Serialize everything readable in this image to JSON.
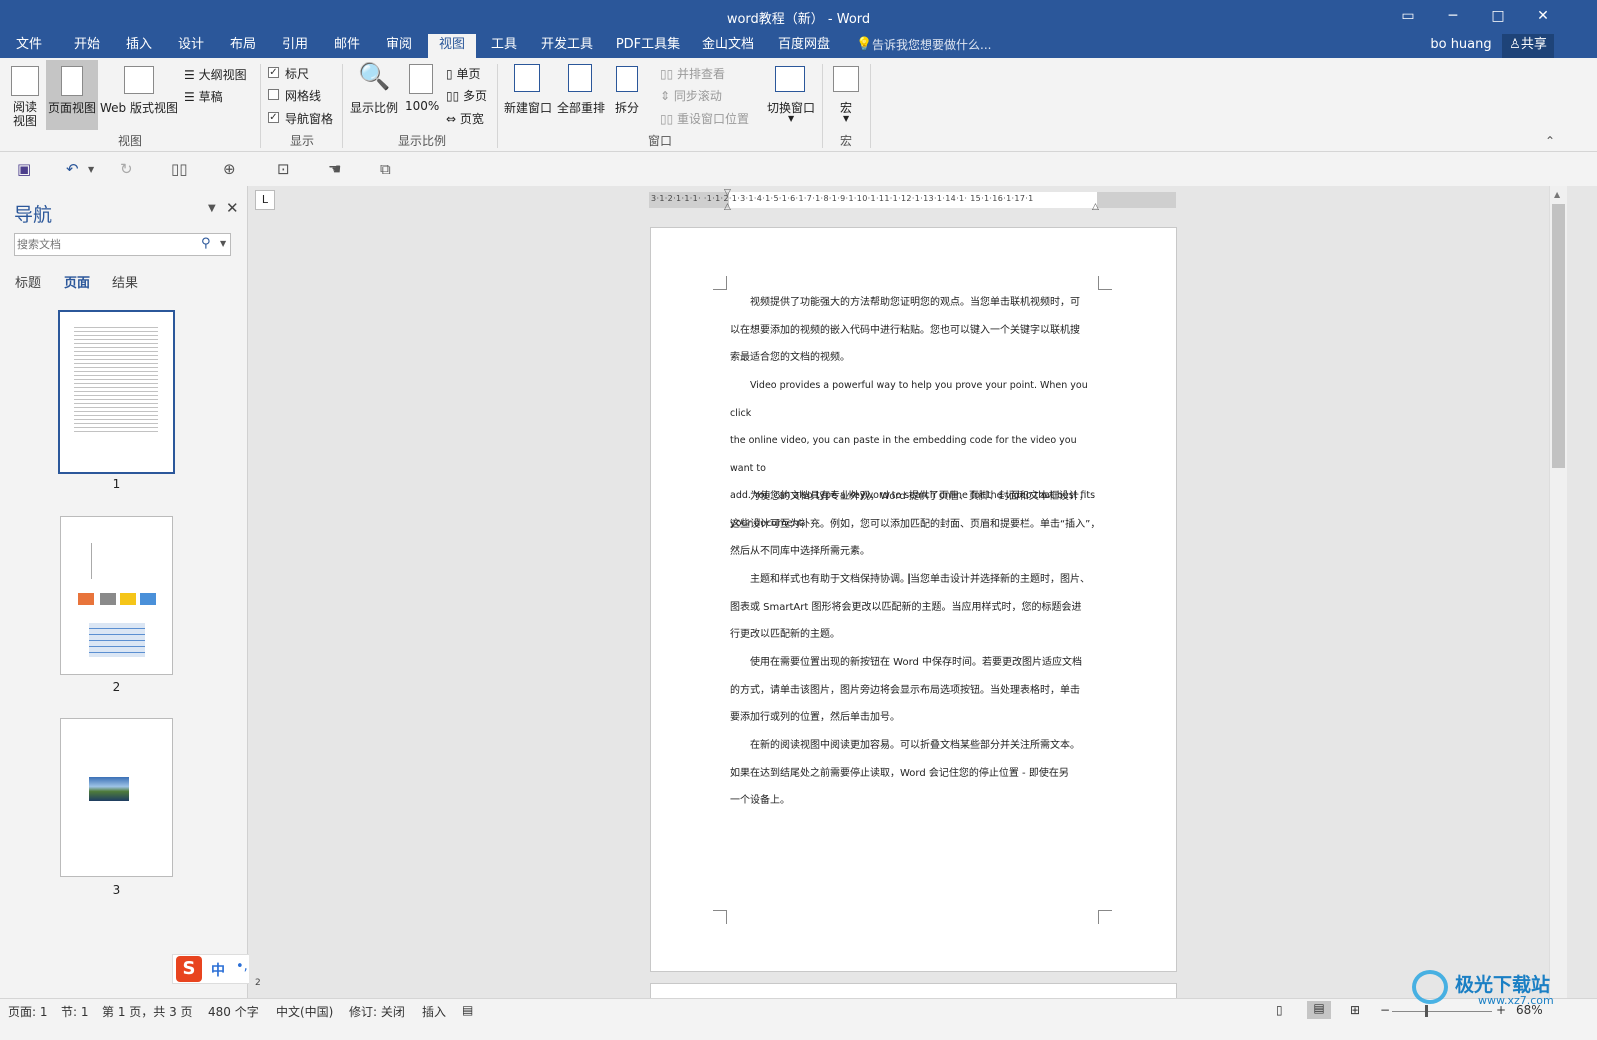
{
  "window": {
    "title": "word教程（新） - Word",
    "user": "bo huang",
    "share_label": "共享",
    "colors": {
      "title_bar": "#2b579a",
      "ribbon": "#f3f3f3",
      "accent": "#2b579a"
    }
  },
  "tabs": [
    {
      "label": "文件"
    },
    {
      "label": "开始"
    },
    {
      "label": "插入"
    },
    {
      "label": "设计"
    },
    {
      "label": "布局"
    },
    {
      "label": "引用"
    },
    {
      "label": "邮件"
    },
    {
      "label": "审阅"
    },
    {
      "label": "视图",
      "active": true
    },
    {
      "label": "工具"
    },
    {
      "label": "开发工具"
    },
    {
      "label": "PDF工具集"
    },
    {
      "label": "金山文档"
    },
    {
      "label": "百度网盘"
    }
  ],
  "tell_me": "告诉我您想要做什么...",
  "ribbon": {
    "views": {
      "read": "阅读\n视图",
      "read_l1": "阅读",
      "read_l2": "视图",
      "print_layout": "页面视图",
      "web_layout": "Web 版式视图",
      "outline": "大纲视图",
      "draft": "草稿",
      "group": "视图"
    },
    "show": {
      "ruler": "标尺",
      "gridlines": "网格线",
      "nav_pane": "导航窗格",
      "ruler_checked": true,
      "gridlines_checked": false,
      "nav_pane_checked": true,
      "group": "显示"
    },
    "zoom": {
      "zoom": "显示比例",
      "hundred": "100%",
      "one_page": "单页",
      "multi_page": "多页",
      "page_width": "页宽",
      "group": "显示比例"
    },
    "window": {
      "new_window": "新建窗口",
      "arrange_all": "全部重排",
      "split": "拆分",
      "side_by_side": "并排查看",
      "sync_scroll": "同步滚动",
      "reset_position": "重设窗口位置",
      "switch_window": "切换窗口",
      "group": "窗口"
    },
    "macros": {
      "macro": "宏",
      "group": "宏"
    }
  },
  "nav": {
    "title": "导航",
    "search_placeholder": "搜索文档",
    "tabs": [
      "标题",
      "页面",
      "结果"
    ],
    "active_tab": "页面",
    "thumbnails": [
      "1",
      "2",
      "3"
    ]
  },
  "document": {
    "paragraphs": [
      {
        "indent": true,
        "lines": [
          "视频提供了功能强大的方法帮助您证明您的观点。当您单击联机视频时，可",
          "以在想要添加的视频的嵌入代码中进行粘贴。您也可以键入一个关键字以联机搜",
          "索最适合您的文档的视频。"
        ]
      },
      {
        "indent": true,
        "lines": [
          "Video provides a powerful way to help you prove your point. When you click",
          "the online video, you can paste in the embedding code for the video you want to",
          "add. You can also type a keyword to search online for the video that best fits",
          "your document."
        ]
      },
      {
        "indent": true,
        "lines": [
          "为使您的文档具有专业外观，Word 提供了页眉、页脚、封面和文本框设计，",
          "这些设计可互为补充。例如，您可以添加匹配的封面、页眉和提要栏。单击“插入”，",
          "然后从不同库中选择所需元素。"
        ]
      },
      {
        "indent": true,
        "lines": [
          "主题和样式也有助于文档保持协调。当您单击设计并选择新的主题时，图片、",
          "图表或 SmartArt 图形将会更改以匹配新的主题。当应用样式时，您的标题会进",
          "行更改以匹配新的主题。"
        ]
      },
      {
        "indent": true,
        "lines": [
          "使用在需要位置出现的新按钮在 Word 中保存时间。若要更改图片适应文档",
          "的方式，请单击该图片，图片旁边将会显示布局选项按钮。当处理表格时，单击",
          "要添加行或列的位置，然后单击加号。"
        ]
      },
      {
        "indent": true,
        "lines": [
          "在新的阅读视图中阅读更加容易。可以折叠文档某些部分并关注所需文本。",
          "如果在达到结尾处之前需要停止读取，Word 会记住您的停止位置 - 即使在另",
          "一个设备上。"
        ]
      }
    ],
    "ruler_text": "3·1·2·1·1·1·  ·1·1·2·1·3·1·4·1·5·1·6·1·7·1·8·1·9·1·10·1·11·1·12·1·13·1·14·1·  15·1·16·1·17·1",
    "tab_stop": "L",
    "ruler_left_num": "2"
  },
  "ime": {
    "logo": "S",
    "lang": "中",
    "punct": "•,"
  },
  "status": {
    "page": "页面: 1",
    "section": "节: 1",
    "page_of": "第 1 页，共 3 页",
    "words": "480 个字",
    "language": "中文(中国)",
    "track": "修订: 关闭",
    "insert": "插入",
    "zoom": "68%",
    "zoom_level": 0.68
  },
  "watermark": {
    "text": "极光下载站",
    "url": "www.xz7.com"
  }
}
